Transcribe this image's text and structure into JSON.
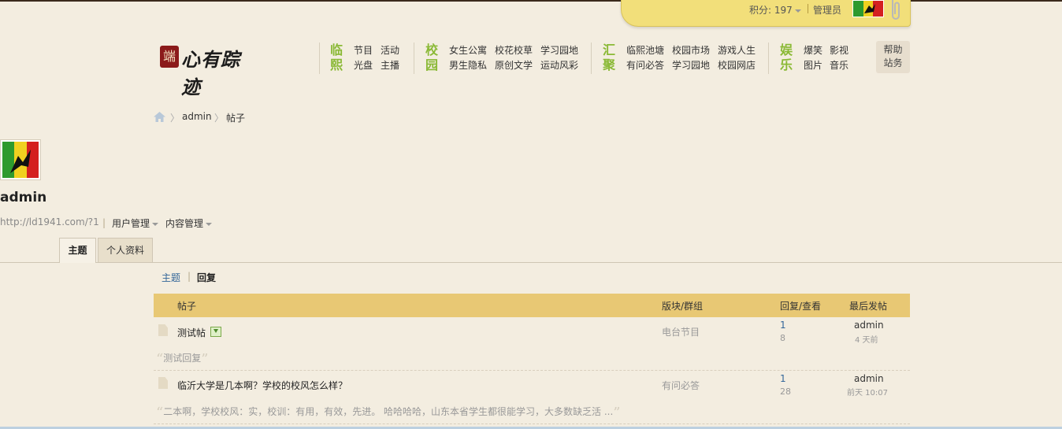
{
  "userbar": {
    "score": "积分: 197",
    "role": "管理员"
  },
  "logo": {
    "seal_char": "端",
    "script": "心有踪迹"
  },
  "nav": [
    {
      "title": [
        "临",
        "熙"
      ],
      "items": [
        "节目",
        "活动",
        "光盘",
        "主播"
      ]
    },
    {
      "title": [
        "校",
        "园"
      ],
      "items": [
        "女生公寓",
        "校花校草",
        "学习园地",
        "男生隐私",
        "原创文学",
        "运动风彩"
      ]
    },
    {
      "title": [
        "汇",
        "聚"
      ],
      "items": [
        "临熙池塘",
        "校园市场",
        "游戏人生",
        "有问必答",
        "学习园地",
        "校园网店"
      ]
    },
    {
      "title": [
        "娱",
        "乐"
      ],
      "items": [
        "爆笑",
        "影视",
        "图片",
        "音乐"
      ]
    }
  ],
  "help": [
    "帮助",
    "站务"
  ],
  "breadcrumb": [
    "admin",
    "帖子"
  ],
  "profile": {
    "username": "admin",
    "url": "http://ld1941.com/?1",
    "menus": [
      "用户管理",
      "内容管理"
    ]
  },
  "tabs": [
    "主题",
    "个人资料"
  ],
  "subfilters": [
    "主题",
    "回复"
  ],
  "table": {
    "headers": [
      "帖子",
      "版块/群组",
      "回复/查看",
      "最后发帖"
    ],
    "rows": [
      {
        "title": "测试帖",
        "forum": "电台节目",
        "replies": "1",
        "views": "8",
        "last_user": "admin",
        "last_time": "4 天前",
        "snippet": "测试回复"
      },
      {
        "title": "临沂大学是几本啊？学校的校风怎么样？",
        "forum": "有问必答",
        "replies": "1",
        "views": "28",
        "last_user": "admin",
        "last_time": "前天 10:07",
        "snippet": "二本啊，学校校风：实，校训：有用，有效，先进。 哈哈哈哈，山东本省学生都很能学习，大多数缺乏活 ..."
      }
    ]
  },
  "colors": {
    "accent_green": "#8ab935",
    "header_gold": "#e8c874",
    "note_yellow": "#f2df7a"
  }
}
